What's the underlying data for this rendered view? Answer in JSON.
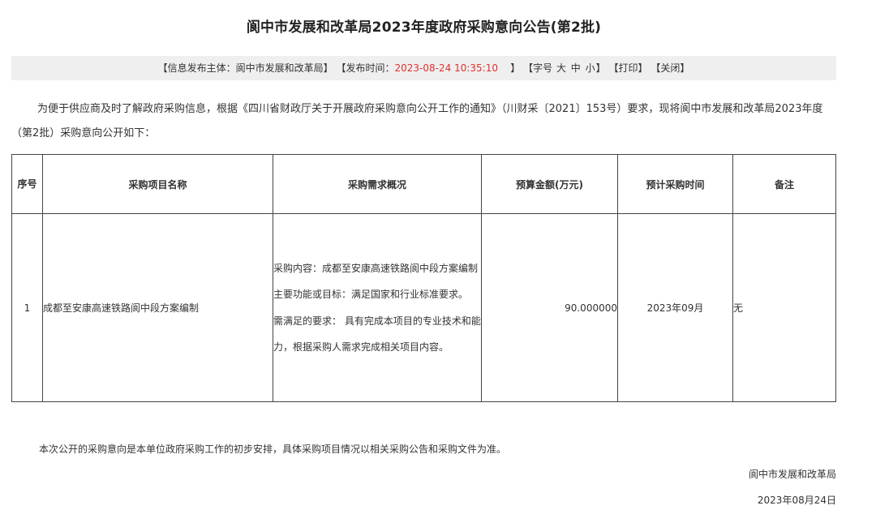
{
  "title": "阆中市发展和改革局2023年度政府采购意向公告(第2批)",
  "info_bar": {
    "publisher_label": "【信息发布主体：",
    "publisher": "阆中市发展和改革局",
    "publisher_close": "】",
    "time_label": "【发布时间：",
    "time": "2023-08-24 10:35:10",
    "time_close": "】",
    "font_label": "【字号",
    "font_large": "大",
    "font_medium": "中",
    "font_small": "小",
    "font_close": "】",
    "print": "【打印】",
    "close": "【关闭】"
  },
  "intro": "为便于供应商及时了解政府采购信息，根据《四川省财政厅关于开展政府采购意向公开工作的通知》（川财采〔2021〕153号）要求，现将阆中市发展和改革局2023年度（第2批）采购意向公开如下：",
  "table": {
    "headers": {
      "seq": "序号",
      "name": "采购项目名称",
      "requirement": "采购需求概况",
      "budget": "预算金额(万元)",
      "time": "预计采购时间",
      "remark": "备注"
    },
    "rows": [
      {
        "seq": "1",
        "name": "成都至安康高速铁路阆中段方案编制",
        "requirement": {
          "content": "采购内容：成都至安康高速铁路阆中段方案编制",
          "function": "主要功能或目标：满足国家和行业标准要求。",
          "needs": "需满足的要求： 具有完成本项目的专业技术和能力，根据采购人需求完成相关项目内容。"
        },
        "budget": "90.000000",
        "time": "2023年09月",
        "remark": "无"
      }
    ]
  },
  "note": "本次公开的采购意向是本单位政府采购工作的初步安排，具体采购项目情况以相关采购公告和采购文件为准。",
  "org": "阆中市发展和改革局",
  "date": "2023年08月24日",
  "colors": {
    "info_bar_bg": "#efefef",
    "highlight": "#e0322d",
    "border": "#444444"
  }
}
